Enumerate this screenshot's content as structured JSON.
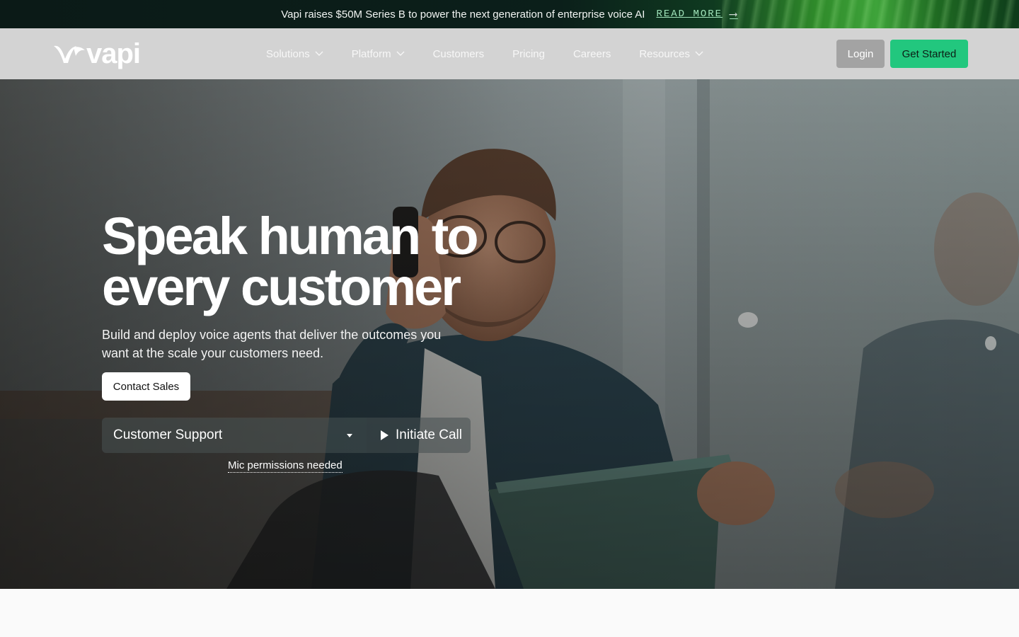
{
  "announcement": {
    "message": "Vapi raises $50M Series B to power the next generation of enterprise voice AI",
    "link_label": "READ MORE",
    "arrow": "⟶"
  },
  "nav": {
    "logo_text": "vapi",
    "menu": [
      {
        "label": "Solutions",
        "has_dropdown": true,
        "icon": "chevron-down-icon"
      },
      {
        "label": "Platform",
        "has_dropdown": true,
        "icon": "chevron-down-icon"
      },
      {
        "label": "Customers",
        "has_dropdown": false
      },
      {
        "label": "Pricing",
        "has_dropdown": false
      },
      {
        "label": "Careers",
        "has_dropdown": false
      },
      {
        "label": "Resources",
        "has_dropdown": true,
        "icon": "chevron-down-icon"
      }
    ],
    "login_label": "Login",
    "get_started_label": "Get Started"
  },
  "hero": {
    "title_line1": "Speak human to",
    "title_line2": "every customer",
    "subtitle": "Build and deploy voice agents that deliver the outcomes you want at the scale your customers need.",
    "contact_label": "Contact Sales",
    "select_value": "Customer Support",
    "call_label": "Initiate Call",
    "mic_note": "Mic permissions needed"
  },
  "colors": {
    "accent": "#22c77e",
    "nav_bg": "#d3d3d3",
    "login_bg": "#a3a3a3",
    "announce_bg": "#0b1a17",
    "link_color": "#9fe3b9"
  }
}
